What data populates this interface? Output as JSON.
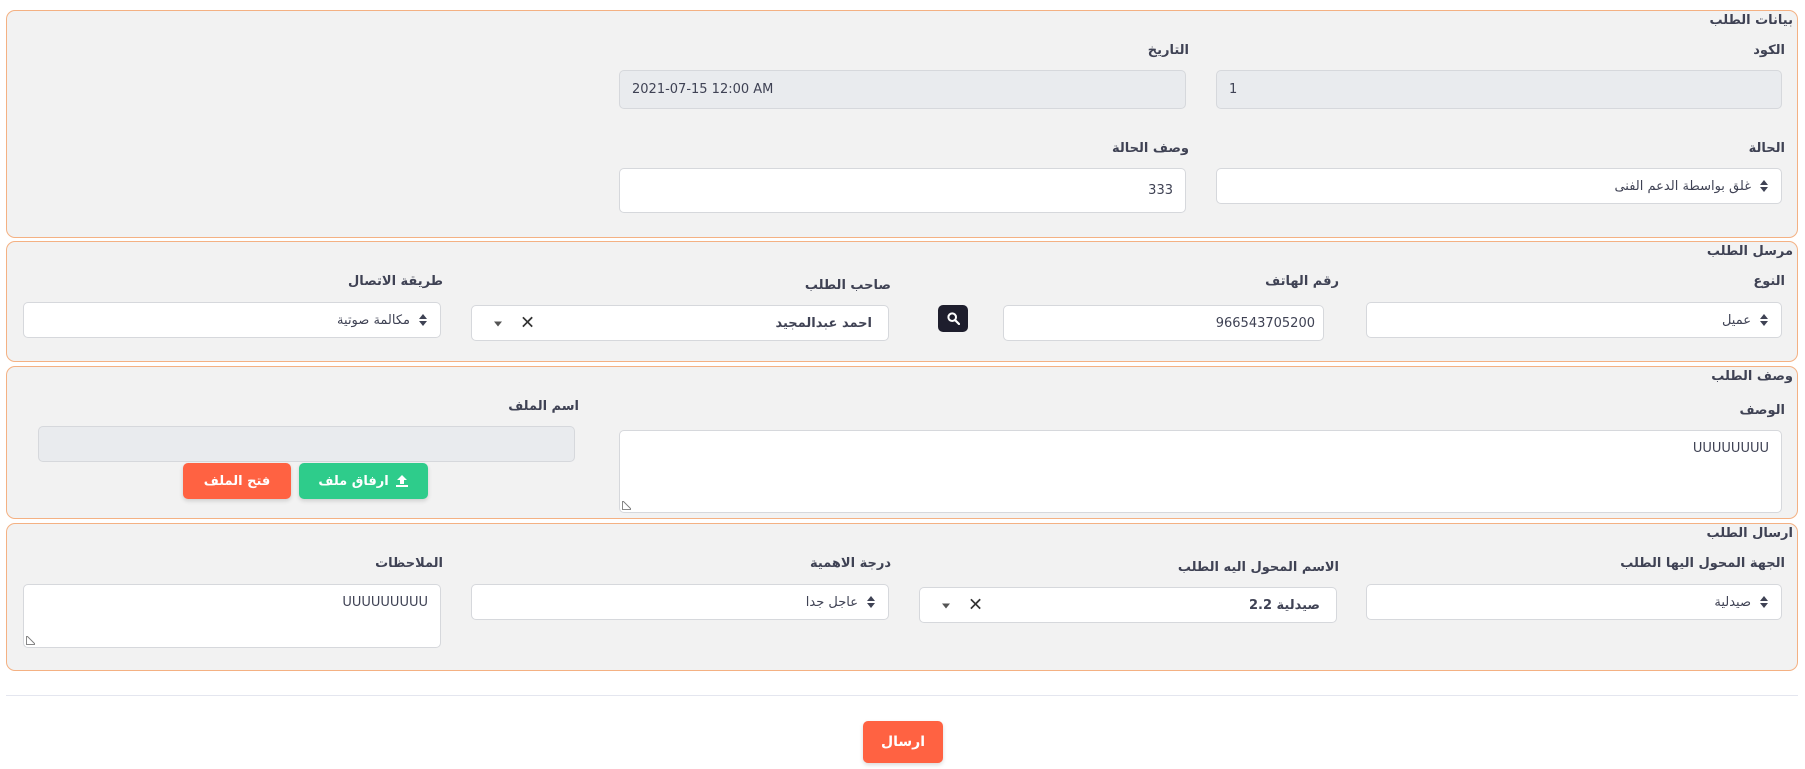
{
  "colors": {
    "panel_border": "#f4b183",
    "panel_bg": "#f2f2f2",
    "primary_orange": "#ff6242",
    "success_green": "#2ecc8b",
    "dark_button": "#1e1e2d"
  },
  "request_data": {
    "legend": "بيانات الطلب",
    "code_label": "الكود",
    "code_value": "1",
    "date_label": "التاريخ",
    "date_value": "2021-07-15 12:00 AM",
    "status_label": "الحالة",
    "status_value": "غلق بواسطة الدعم الفنى",
    "status_desc_label": "وصف الحالة",
    "status_desc_value": "333"
  },
  "sender": {
    "legend": "مرسل الطلب",
    "type_label": "النوع",
    "type_value": "عميل",
    "phone_label": "رقم الهاتف",
    "phone_value": "966543705200",
    "owner_label": "صاحب الطلب",
    "owner_value": "احمد عبدالمجيد",
    "contact_label": "طريقة الاتصال",
    "contact_value": "مكالمة صوتية",
    "search_icon": "search-icon"
  },
  "description": {
    "legend": "وصف الطلب",
    "desc_label": "الوصف",
    "desc_value": "UUUUUUUU",
    "file_label": "اسم الملف",
    "file_value": "",
    "attach_button": "ارفاق ملف",
    "attach_icon": "upload-icon",
    "open_button": "فتح الملف"
  },
  "dispatch": {
    "legend": "ارسال الطلب",
    "dest_label": "الجهة المحول اليها الطلب",
    "dest_value": "صيدلية",
    "assignee_label": "الاسم المحول اليه الطلب",
    "assignee_value": "صيدلية 2.2",
    "priority_label": "درجة الاهمية",
    "priority_value": "عاجل جدا",
    "notes_label": "الملاحظات",
    "notes_value": "UUUUUUUUU"
  },
  "submit_button": "ارسال"
}
